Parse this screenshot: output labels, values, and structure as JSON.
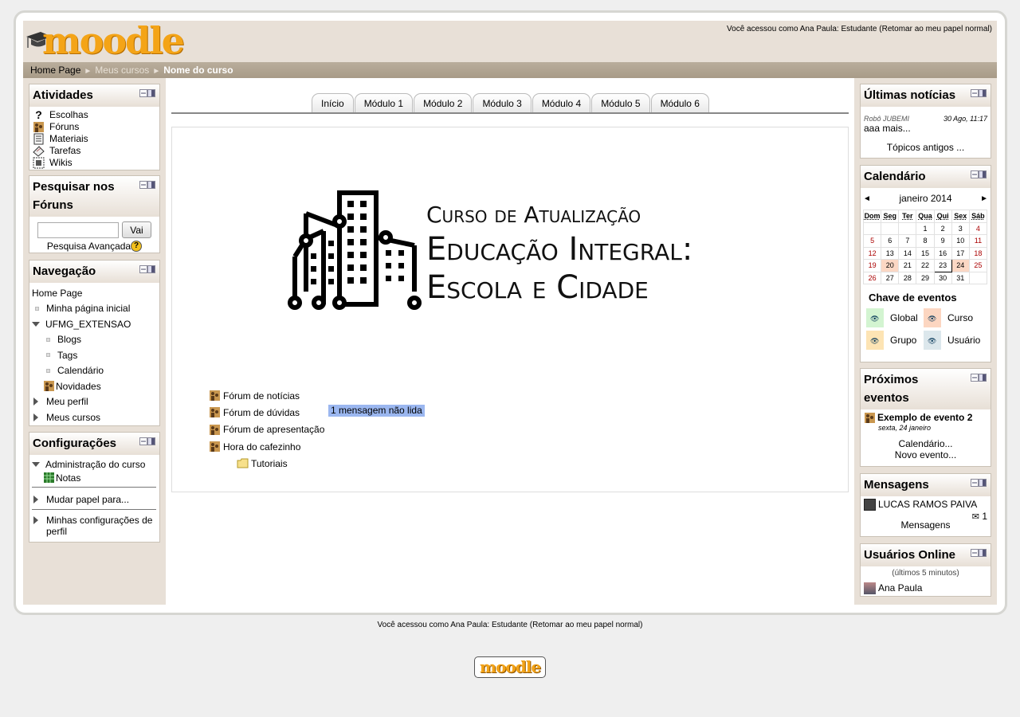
{
  "header": {
    "logo_text": "moodle",
    "login_info": "Você acessou como Ana Paula: Estudante (Retomar ao meu papel normal)"
  },
  "breadcrumb": {
    "home": "Home Page",
    "my_courses": "Meus cursos",
    "current": "Nome do curso",
    "separator": "►"
  },
  "blocks": {
    "activities": {
      "title": "Atividades",
      "items": [
        "Escolhas",
        "Fóruns",
        "Materiais",
        "Tarefas",
        "Wikis"
      ]
    },
    "search": {
      "title": "Pesquisar nos Fóruns",
      "button": "Vai",
      "advanced": "Pesquisa Avançada",
      "input_value": ""
    },
    "navigation": {
      "title": "Navegação",
      "home": "Home Page",
      "my_home": "Minha página inicial",
      "course": "UFMG_EXTENSAO",
      "course_items": [
        "Blogs",
        "Tags",
        "Calendário",
        "Novidades"
      ],
      "profile": "Meu perfil",
      "my_courses": "Meus cursos"
    },
    "settings": {
      "title": "Configurações",
      "admin": "Administração do curso",
      "grades": "Notas",
      "switch_role": "Mudar papel para...",
      "my_settings": "Minhas configurações de perfil"
    },
    "news": {
      "title": "Últimas notícias",
      "author": "Robô JUBEMI",
      "date": "30 Ago, 11:17",
      "text": "aaa mais...",
      "older": "Tópicos antigos ..."
    },
    "calendar": {
      "title": "Calendário",
      "month": "janeiro 2014",
      "prev": "◄",
      "next": "►",
      "days": [
        "Dom",
        "Seg",
        "Ter",
        "Qua",
        "Qui",
        "Sex",
        "Sáb"
      ],
      "weeks": [
        [
          "",
          "",
          "",
          "1",
          "2",
          "3",
          "4"
        ],
        [
          "5",
          "6",
          "7",
          "8",
          "9",
          "10",
          "11"
        ],
        [
          "12",
          "13",
          "14",
          "15",
          "16",
          "17",
          "18"
        ],
        [
          "19",
          "20",
          "21",
          "22",
          "23",
          "24",
          "25"
        ],
        [
          "26",
          "27",
          "28",
          "29",
          "30",
          "31",
          ""
        ]
      ],
      "event_days": [
        "20",
        "24"
      ],
      "today": "23",
      "legend_title": "Chave de eventos",
      "legend": [
        {
          "label": "Global",
          "color": "#d3f4d1"
        },
        {
          "label": "Curso",
          "color": "#fcd6c1"
        },
        {
          "label": "Grupo",
          "color": "#fde4b4"
        },
        {
          "label": "Usuário",
          "color": "#dce7ec"
        }
      ]
    },
    "upcoming": {
      "title": "Próximos eventos",
      "event": "Exemplo de evento 2",
      "event_date": "sexta, 24 janeiro",
      "calendar_link": "Calendário...",
      "new_event": "Novo evento..."
    },
    "messages": {
      "title": "Mensagens",
      "user": "LUCAS RAMOS PAIVA",
      "count": "1",
      "link": "Mensagens"
    },
    "online": {
      "title": "Usuários Online",
      "period": "(últimos 5 minutos)",
      "user": "Ana Paula"
    }
  },
  "tabs": [
    "Início",
    "Módulo 1",
    "Módulo 2",
    "Módulo 3",
    "Módulo 4",
    "Módulo 5",
    "Módulo 6"
  ],
  "course_banner": {
    "line1": "Curso de Atualização",
    "line2": "Educação Integral:",
    "line3": "Escola e Cidade"
  },
  "forums": [
    {
      "label": "Fórum de notícias"
    },
    {
      "label": "Fórum de dúvidas"
    },
    {
      "label": "Fórum de apresentação"
    },
    {
      "label": "Hora do cafezinho"
    }
  ],
  "unread": "1 mensagem não lida",
  "folder": "Tutoriais",
  "footer": {
    "login_info": "Você acessou como Ana Paula: Estudante (Retomar ao meu papel normal)",
    "logo_text": "moodle"
  },
  "colors": {
    "header_bg": "#e8e0d7",
    "breadcrumb_bg": "#b0a38f",
    "accent": "#f4a417",
    "unread_bg": "#9bb7f0"
  }
}
